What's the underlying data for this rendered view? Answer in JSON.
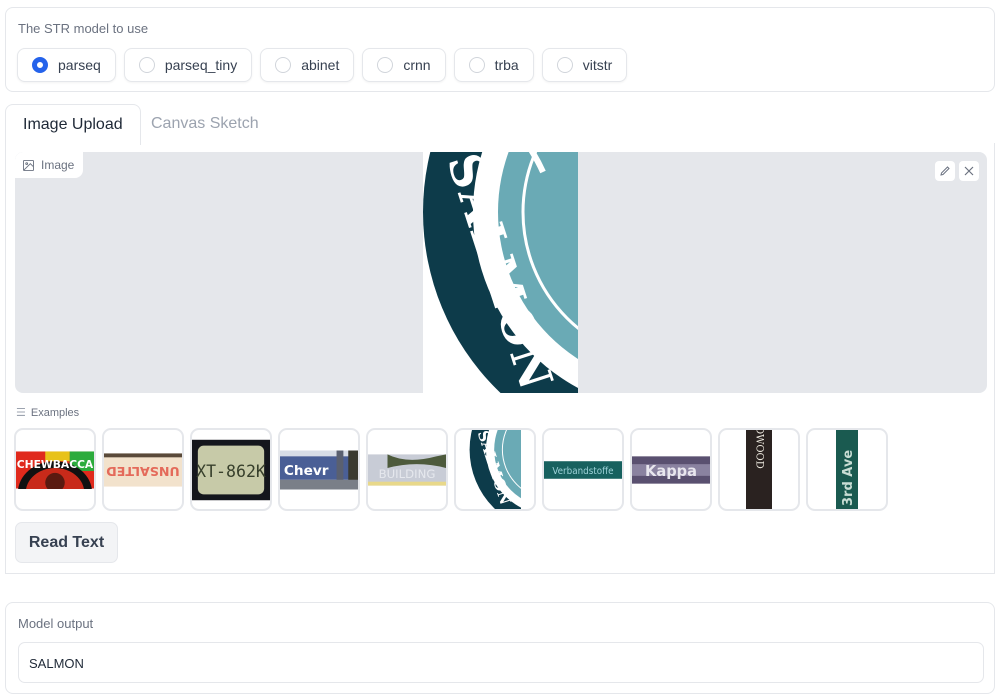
{
  "model_selector": {
    "label": "The STR model to use",
    "options": [
      {
        "label": "parseq",
        "selected": true
      },
      {
        "label": "parseq_tiny",
        "selected": false
      },
      {
        "label": "abinet",
        "selected": false
      },
      {
        "label": "crnn",
        "selected": false
      },
      {
        "label": "trba",
        "selected": false
      },
      {
        "label": "vitstr",
        "selected": false
      }
    ],
    "accent_color": "#2563eb"
  },
  "tabs": [
    {
      "label": "Image Upload",
      "active": true
    },
    {
      "label": "Canvas Sketch",
      "active": false
    }
  ],
  "image_input": {
    "badge_label": "Image",
    "icons": [
      "image-icon",
      "pencil-icon",
      "close-icon"
    ],
    "current_image_text": "SALMON"
  },
  "examples": {
    "label": "Examples",
    "items": [
      {
        "name": "chewbacca",
        "text": "CHEWBACCA"
      },
      {
        "name": "unsalted",
        "text": "UNSALTED"
      },
      {
        "name": "license-plate",
        "text": "XT-862K"
      },
      {
        "name": "chevron",
        "text": "Chevr"
      },
      {
        "name": "building",
        "text": "BUILDING"
      },
      {
        "name": "salmon",
        "text": "SALMON"
      },
      {
        "name": "verbandstoffe",
        "text": "Verbandstoffe"
      },
      {
        "name": "kappa",
        "text": "Kappa"
      },
      {
        "name": "redwood",
        "text": "REDWOOD"
      },
      {
        "name": "3rd-ave",
        "text": "3rd Ave"
      }
    ]
  },
  "read_button": {
    "label": "Read Text"
  },
  "output": {
    "label": "Model output",
    "value": "SALMON"
  }
}
